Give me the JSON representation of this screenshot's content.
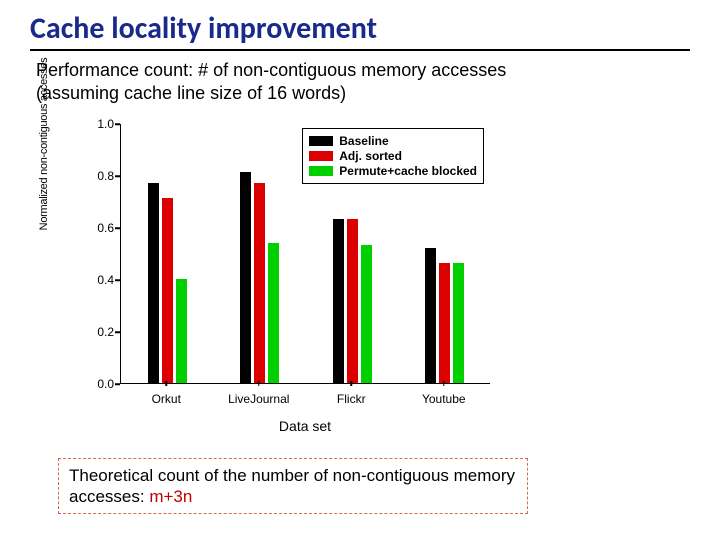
{
  "title": "Cache locality improvement",
  "subtitle_line1": "Performance count: # of non-contiguous memory accesses",
  "subtitle_line2": "(assuming cache line size of 16 words)",
  "y_rot_label": "Normalized non-contiguous accesses",
  "xlabel": "Data set",
  "yticks": [
    "0.0",
    "0.2",
    "0.4",
    "0.6",
    "0.8",
    "1.0"
  ],
  "legend": {
    "baseline": "Baseline",
    "adj": "Adj. sorted",
    "perm": "Permute+cache blocked"
  },
  "footer_prefix": "Theoretical count of the number of non-contiguous memory accesses: ",
  "footer_highlight": "m+3n",
  "chart_data": {
    "type": "bar",
    "categories": [
      "Orkut",
      "LiveJournal",
      "Flickr",
      "Youtube"
    ],
    "series": [
      {
        "name": "Baseline",
        "values": [
          0.77,
          0.81,
          0.63,
          0.52
        ]
      },
      {
        "name": "Adj. sorted",
        "values": [
          0.71,
          0.77,
          0.63,
          0.46
        ]
      },
      {
        "name": "Permute+cache blocked",
        "values": [
          0.4,
          0.54,
          0.53,
          0.46
        ]
      }
    ],
    "ylim": [
      0.0,
      1.0
    ],
    "yticks": [
      0.0,
      0.2,
      0.4,
      0.6,
      0.8,
      1.0
    ],
    "xlabel": "Data set",
    "ylabel": "Normalized non-contiguous accesses",
    "title": "",
    "legend_position": "upper-right"
  }
}
